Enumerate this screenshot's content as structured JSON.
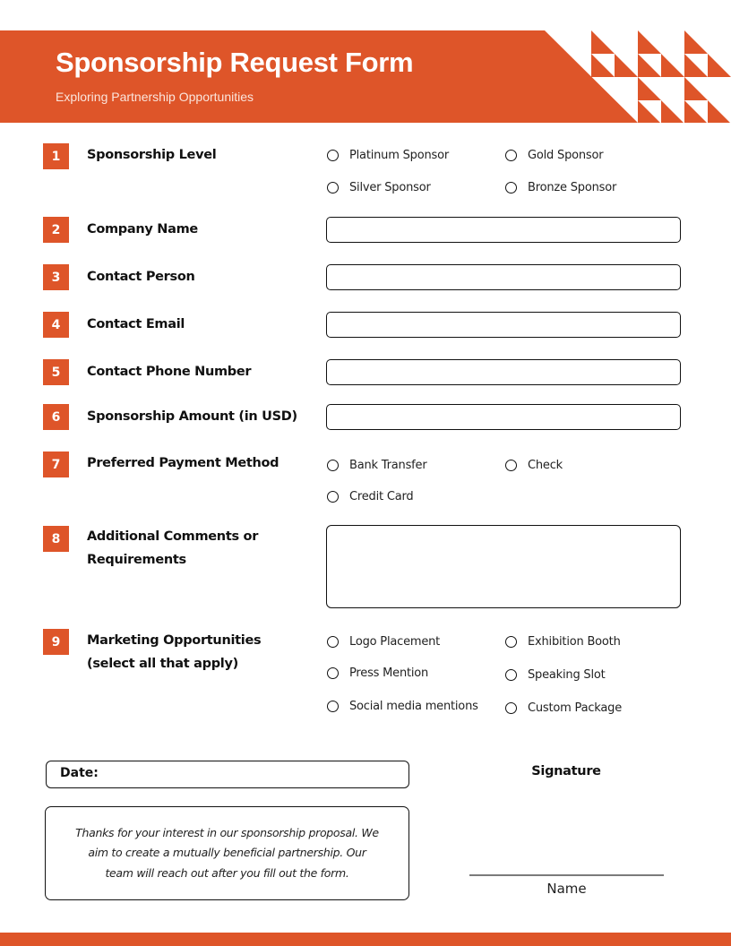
{
  "header": {
    "title": "Sponsorship Request Form",
    "subtitle": "Exploring Partnership Opportunities",
    "accent_color": "#de5529"
  },
  "questions": [
    {
      "number": "1",
      "label": "Sponsorship Level",
      "type": "radio",
      "options": [
        "Platinum Sponsor",
        "Gold Sponsor",
        "Silver Sponsor",
        "Bronze Sponsor"
      ]
    },
    {
      "number": "2",
      "label": "Company Name",
      "type": "text",
      "value": ""
    },
    {
      "number": "3",
      "label": "Contact Person",
      "type": "text",
      "value": ""
    },
    {
      "number": "4",
      "label": "Contact Email",
      "type": "text",
      "value": ""
    },
    {
      "number": "5",
      "label": "Contact Phone Number",
      "type": "text",
      "value": ""
    },
    {
      "number": "6",
      "label": "Sponsorship Amount (in USD)",
      "type": "text",
      "value": ""
    },
    {
      "number": "7",
      "label": "Preferred Payment Method",
      "type": "radio",
      "options": [
        "Bank Transfer",
        "Check",
        "Credit Card"
      ]
    },
    {
      "number": "8",
      "label_line1": "Additional Comments or",
      "label_line2": "Requirements",
      "type": "textarea",
      "value": ""
    },
    {
      "number": "9",
      "label_line1": "Marketing Opportunities",
      "label_line2": "(select all that apply)",
      "type": "checkbox",
      "options": [
        "Logo Placement",
        "Exhibition Booth",
        "Press Mention",
        "Speaking Slot",
        "Social media mentions",
        "Custom Package"
      ]
    }
  ],
  "footer": {
    "date_label": "Date:",
    "note_line1": "Thanks for your interest in our sponsorship proposal. We",
    "note_line2": "aim to create a mutually beneficial partnership. Our",
    "note_line3": "team will reach out after you fill out the form.",
    "signature_label": "Signature",
    "name_label": "Name"
  }
}
